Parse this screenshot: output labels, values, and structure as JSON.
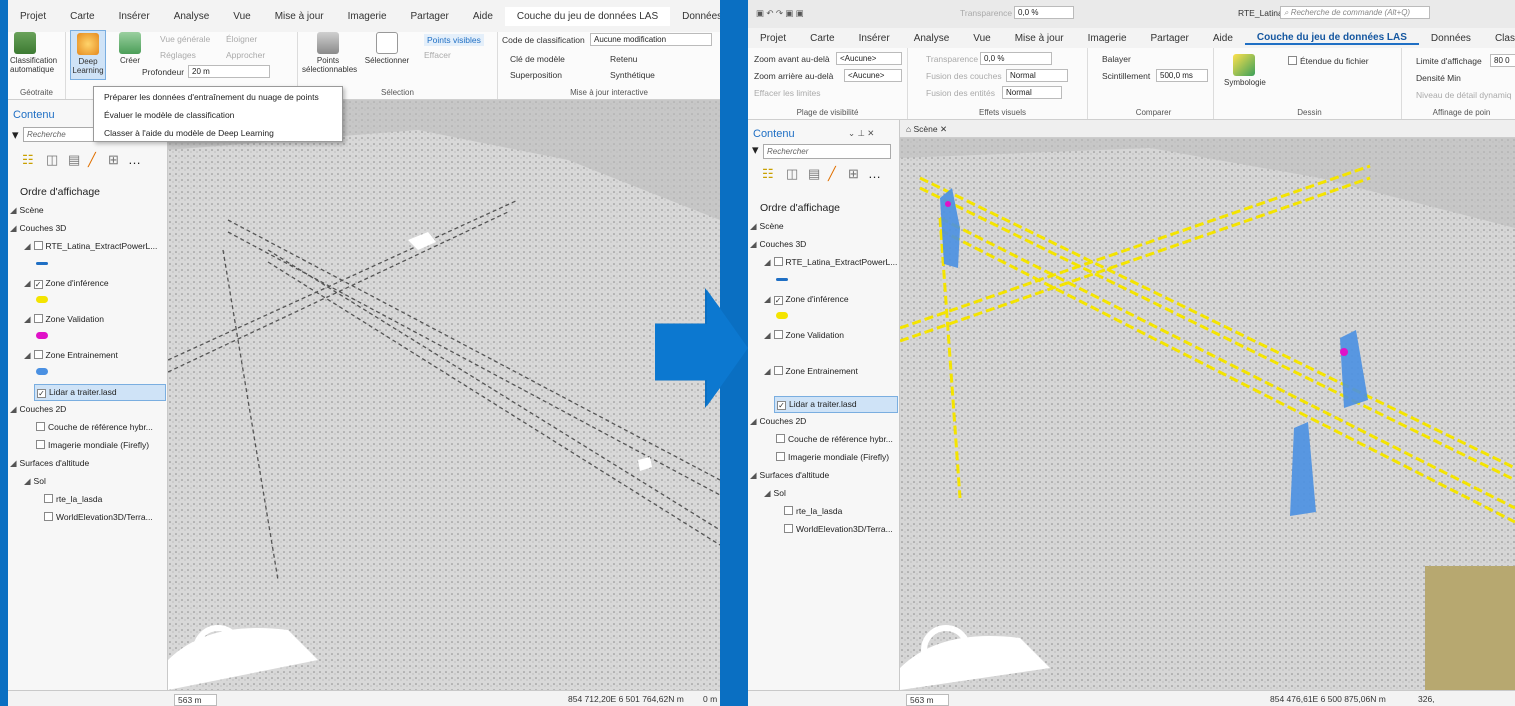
{
  "left": {
    "tabs": [
      "Projet",
      "Carte",
      "Insérer",
      "Analyse",
      "Vue",
      "Mise à jour",
      "Imagerie",
      "Partager",
      "Aide",
      "Couche du jeu de données LAS",
      "Données"
    ],
    "ribbon": {
      "classification_auto": "Classification automatique",
      "deep_learning": "Deep Learning",
      "geotraitement_label": "Géotraite",
      "vue_generale": "Vue générale",
      "eloigner": "Éloigner",
      "reglages": "Réglages",
      "approcher": "Approcher",
      "creer": "Créer",
      "profondeur_label": "Profondeur",
      "profondeur_value": "20 m",
      "points_selectionnables": "Points sélectionnables",
      "selectionner": "Sélectionner",
      "points_visibles": "Points visibles",
      "effacer": "Effacer",
      "selection_label": "Sélection",
      "code_classification": "Code de classification",
      "aucune_modification": "Aucune modification",
      "cle_modele": "Clé de modèle",
      "retenu": "Retenu",
      "superposition": "Superposition",
      "synthetique": "Synthétique",
      "maj_interactive": "Mise à jour interactive"
    },
    "dropdown": [
      "Préparer les données d'entraînement du nuage de points",
      "Évaluer le modèle de classification",
      "Classer à l'aide du modèle de Deep Learning"
    ],
    "contents_title": "Contenu",
    "search_placeholder": "Recherche",
    "order": "Ordre d'affichage",
    "status_scale": "563 m",
    "status_coords": "854 712,20E 6 501 764,62N m",
    "status_extra": "0 m"
  },
  "right": {
    "titlebar": {
      "transparency_label": "Transparence",
      "transparency_value": "0,0 %",
      "project": "RTE_Latina",
      "command_search": "Recherche de commande (Alt+Q)"
    },
    "tabs": [
      "Projet",
      "Carte",
      "Insérer",
      "Analyse",
      "Vue",
      "Mise à jour",
      "Imagerie",
      "Partager",
      "Aide",
      "Couche du jeu de données LAS",
      "Données",
      "Classification"
    ],
    "ribbon": {
      "zoom_avant": "Zoom avant au-delà",
      "zoom_arriere": "Zoom arrière au-delà",
      "aucune": "<Aucune>",
      "effacer_limites": "Effacer les limites",
      "plage_visibilite": "Plage de visibilité",
      "transparence": "Transparence",
      "transparence_value": "0,0 %",
      "fusion_couches": "Fusion des couches",
      "fusion_entites": "Fusion des entités",
      "normal": "Normal",
      "effets_visuels": "Effets visuels",
      "balayer": "Balayer",
      "scintillement": "Scintillement",
      "scintillement_value": "500,0 ms",
      "comparer": "Comparer",
      "symbologie": "Symbologie",
      "etendue_fichier": "Étendue du fichier",
      "dessin": "Dessin",
      "limite_affichage": "Limite d'affichage",
      "limite_value": "80 0",
      "densite_min": "Densité Min",
      "niveau_detail": "Niveau de détail dynamiq",
      "affinage": "Affinage de poin"
    },
    "contents_title": "Contenu",
    "search_placeholder": "Rechercher",
    "order": "Ordre d'affichage",
    "scene_tab": "Scène",
    "status_scale": "563 m",
    "status_coords": "854 476,61E 6 500 875,06N m",
    "status_extra": "326,"
  },
  "tree": {
    "scene": "Scène",
    "couches3d": "Couches 3D",
    "rte": "RTE_Latina_ExtractPowerL...",
    "inference": "Zone d'inférence",
    "validation": "Zone Validation",
    "entrainement": "Zone Entrainement",
    "lidar": "Lidar a traiter.lasd",
    "couches2d": "Couches 2D",
    "reference": "Couche de référence hybr...",
    "imagerie": "Imagerie mondiale (Firefly)",
    "surfaces": "Surfaces d'altitude",
    "sol": "Sol",
    "rte_lasda": "rte_la_lasda",
    "worldelev": "WorldElevation3D/Terra..."
  },
  "colors": {
    "background": "#0a6fc2",
    "accent": "#1f6fc4",
    "inference": "#f4e400",
    "validation": "#e012c8",
    "entrainement": "#4a90e2"
  }
}
